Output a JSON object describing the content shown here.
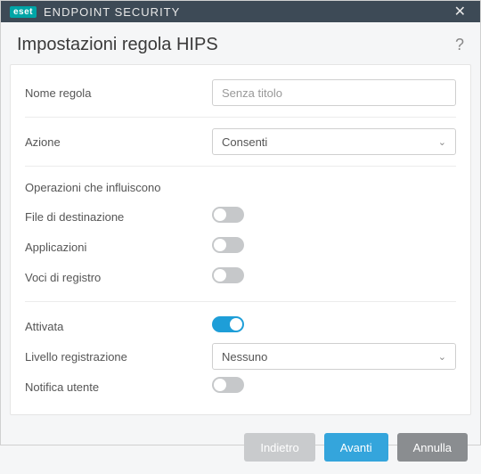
{
  "titlebar": {
    "brand_short": "eset",
    "brand_text": "ENDPOINT SECURITY"
  },
  "header": {
    "title": "Impostazioni regola HIPS",
    "help_glyph": "?"
  },
  "fields": {
    "rule_name": {
      "label": "Nome regola",
      "placeholder": "Senza titolo",
      "value": ""
    },
    "action": {
      "label": "Azione",
      "value": "Consenti"
    },
    "operations_section": "Operazioni che influiscono",
    "target_files": {
      "label": "File di destinazione",
      "on": false
    },
    "applications": {
      "label": "Applicazioni",
      "on": false
    },
    "registry_entries": {
      "label": "Voci di registro",
      "on": false
    },
    "enabled": {
      "label": "Attivata",
      "on": true
    },
    "log_level": {
      "label": "Livello registrazione",
      "value": "Nessuno"
    },
    "notify_user": {
      "label": "Notifica utente",
      "on": false
    }
  },
  "footer": {
    "back": "Indietro",
    "next": "Avanti",
    "cancel": "Annulla"
  }
}
